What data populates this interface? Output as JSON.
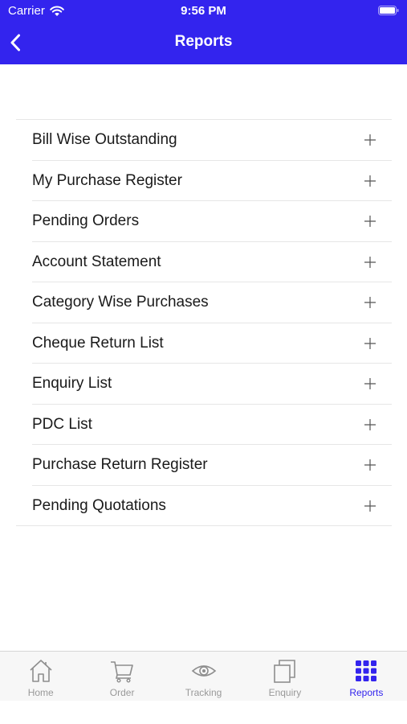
{
  "status_bar": {
    "carrier": "Carrier",
    "time": "9:56 PM"
  },
  "nav": {
    "title": "Reports",
    "back_icon": "chevron-left-icon"
  },
  "colors": {
    "accent": "#3324ee",
    "inactive_tab": "#999999",
    "divider": "#e6e6e6"
  },
  "reports": [
    {
      "label": "Bill Wise Outstanding"
    },
    {
      "label": "My Purchase Register"
    },
    {
      "label": "Pending Orders"
    },
    {
      "label": "Account Statement"
    },
    {
      "label": "Category Wise Purchases"
    },
    {
      "label": "Cheque Return List"
    },
    {
      "label": "Enquiry List"
    },
    {
      "label": "PDC List"
    },
    {
      "label": "Purchase Return Register"
    },
    {
      "label": "Pending Quotations"
    }
  ],
  "tabs": [
    {
      "label": "Home",
      "icon": "home-icon"
    },
    {
      "label": "Order",
      "icon": "cart-icon"
    },
    {
      "label": "Tracking",
      "icon": "eye-icon"
    },
    {
      "label": "Enquiry",
      "icon": "copy-icon"
    },
    {
      "label": "Reports",
      "icon": "grid-icon",
      "active": true
    }
  ]
}
